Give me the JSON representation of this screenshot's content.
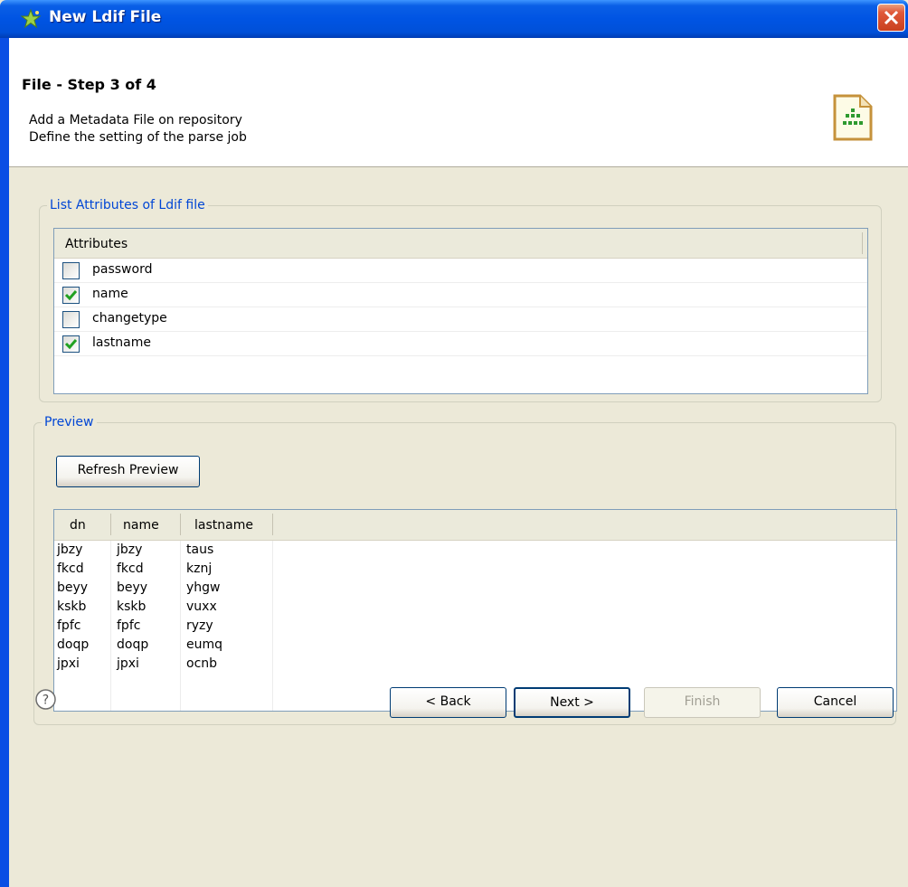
{
  "window": {
    "title": "New Ldif File"
  },
  "header": {
    "title": "File - Step 3 of 4",
    "description_line1": "Add a Metadata File on repository",
    "description_line2": "Define the setting of the parse job"
  },
  "attributes_group": {
    "legend": "List Attributes of Ldif file",
    "column_header": "Attributes",
    "items": [
      {
        "label": "password",
        "checked": false
      },
      {
        "label": "name",
        "checked": true
      },
      {
        "label": "changetype",
        "checked": false
      },
      {
        "label": "lastname",
        "checked": true
      }
    ]
  },
  "preview_group": {
    "legend": "Preview",
    "refresh_label": "Refresh Preview",
    "columns": [
      "dn",
      "name",
      "lastname"
    ],
    "rows": [
      [
        "jbzy",
        "jbzy",
        "taus"
      ],
      [
        "fkcd",
        "fkcd",
        "kznj"
      ],
      [
        "beyy",
        "beyy",
        "yhgw"
      ],
      [
        "kskb",
        "kskb",
        "vuxx"
      ],
      [
        "fpfc",
        "fpfc",
        "ryzy"
      ],
      [
        "doqp",
        "doqp",
        "eumq"
      ],
      [
        "jpxi",
        "jpxi",
        "ocnb"
      ]
    ]
  },
  "footer": {
    "back_label": "< Back",
    "next_label": "Next >",
    "finish_label": "Finish",
    "cancel_label": "Cancel"
  },
  "icons": {
    "title_icon": "star-icon",
    "header_icon": "ldif-file-icon",
    "help_icon": "help-icon",
    "close_icon": "close-icon"
  },
  "colors": {
    "title_bar": "#0054e3",
    "legend_text": "#0046d5",
    "checkmark": "#21a121"
  }
}
